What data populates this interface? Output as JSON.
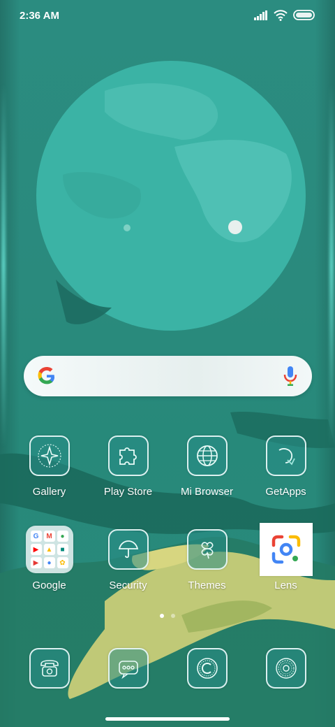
{
  "status_bar": {
    "time": "2:36 AM",
    "icons": [
      "signal-icon",
      "wifi-icon",
      "battery-icon"
    ]
  },
  "search_widget": {
    "logo": "google-g-icon",
    "mic": "mic-icon"
  },
  "home_apps": [
    {
      "label": "Gallery",
      "icon": "gallery-icon"
    },
    {
      "label": "Play Store",
      "icon": "puzzle-icon"
    },
    {
      "label": "Mi Browser",
      "icon": "globe-icon"
    },
    {
      "label": "GetApps",
      "icon": "getapps-icon"
    },
    {
      "label": "Google",
      "icon": "google-folder-icon"
    },
    {
      "label": "Security",
      "icon": "umbrella-icon"
    },
    {
      "label": "Themes",
      "icon": "clover-icon"
    },
    {
      "label": "Lens",
      "icon": "lens-icon"
    }
  ],
  "folder_items": [
    {
      "icon": "google-icon",
      "glyph": "G",
      "color": "#4285f4"
    },
    {
      "icon": "gmail-icon",
      "glyph": "M",
      "color": "#ea4335"
    },
    {
      "icon": "maps-icon",
      "glyph": "●",
      "color": "#34a853"
    },
    {
      "icon": "youtube-icon",
      "glyph": "▶",
      "color": "#ff0000"
    },
    {
      "icon": "drive-icon",
      "glyph": "▲",
      "color": "#fbbc05"
    },
    {
      "icon": "meet-icon",
      "glyph": "■",
      "color": "#00897b"
    },
    {
      "icon": "play-movies-icon",
      "glyph": "▶",
      "color": "#e53935"
    },
    {
      "icon": "assistant-icon",
      "glyph": "●",
      "color": "#4285f4"
    },
    {
      "icon": "photos-icon",
      "glyph": "✿",
      "color": "#fbbc05"
    }
  ],
  "dock_apps": [
    {
      "icon": "phone-icon"
    },
    {
      "icon": "messaging-icon"
    },
    {
      "icon": "browser-c-icon"
    },
    {
      "icon": "camera-icon"
    }
  ],
  "page_indicator": {
    "pages": 2,
    "current": 1
  },
  "colors": {
    "wallpaper_base": "#2a8a7c",
    "moon": "#3bb3a5",
    "google_blue": "#4285f4",
    "google_red": "#ea4335",
    "google_yellow": "#fbbc05",
    "google_green": "#34a853"
  }
}
